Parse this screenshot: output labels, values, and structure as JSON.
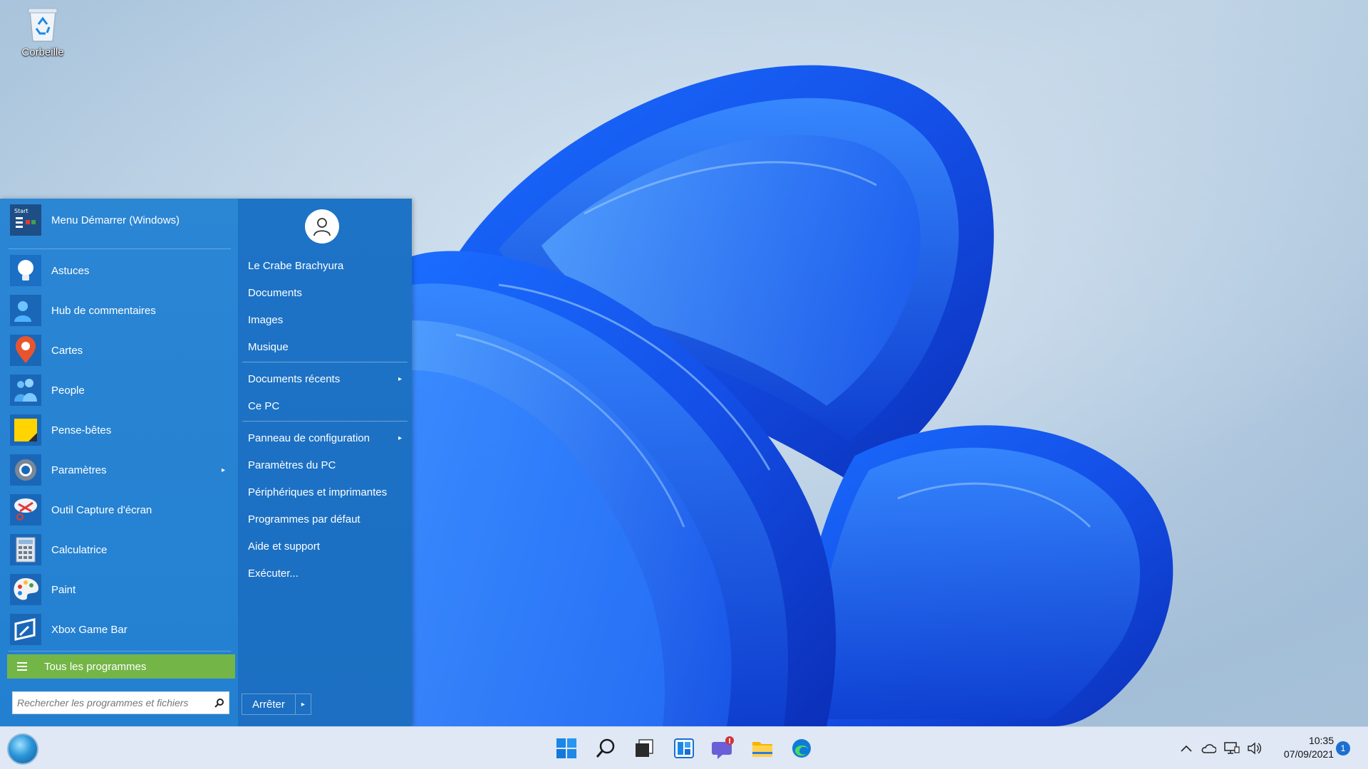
{
  "desktop": {
    "recycle_bin_label": "Corbeille"
  },
  "start_menu": {
    "pinned": [
      {
        "label": "Menu Démarrer (Windows)",
        "icon": "start-menu-icon"
      },
      {
        "label": "Astuces",
        "icon": "lightbulb-icon"
      },
      {
        "label": "Hub de commentaires",
        "icon": "person-feedback-icon"
      },
      {
        "label": "Cartes",
        "icon": "map-pin-icon"
      },
      {
        "label": "People",
        "icon": "people-icon"
      },
      {
        "label": "Pense-bêtes",
        "icon": "sticky-note-icon"
      },
      {
        "label": "Paramètres",
        "icon": "gear-icon",
        "has_submenu": true
      },
      {
        "label": "Outil Capture d'écran",
        "icon": "scissors-icon"
      },
      {
        "label": "Calculatrice",
        "icon": "calculator-icon"
      },
      {
        "label": "Paint",
        "icon": "palette-icon"
      },
      {
        "label": "Xbox Game Bar",
        "icon": "xbox-game-bar-icon"
      }
    ],
    "all_programs_label": "Tous les programmes",
    "search_placeholder": "Rechercher les programmes et fichiers",
    "right_links": [
      {
        "label": "Le Crabe Brachyura"
      },
      {
        "label": "Documents"
      },
      {
        "label": "Images"
      },
      {
        "label": "Musique"
      },
      {
        "label": "Documents récents",
        "has_submenu": true
      },
      {
        "label": "Ce PC"
      },
      {
        "label": "Panneau de configuration",
        "has_submenu": true
      },
      {
        "label": "Paramètres du PC"
      },
      {
        "label": "Périphériques et imprimantes"
      },
      {
        "label": "Programmes par défaut"
      },
      {
        "label": "Aide et support"
      },
      {
        "label": "Exécuter..."
      }
    ],
    "shutdown_label": "Arrêter",
    "accent_color": "#1e78cd",
    "all_programs_color": "#74b547"
  },
  "taskbar": {
    "apps": [
      {
        "name": "windows-start-icon"
      },
      {
        "name": "search-icon"
      },
      {
        "name": "task-view-icon"
      },
      {
        "name": "widgets-icon"
      },
      {
        "name": "teams-chat-icon",
        "badge": "!"
      },
      {
        "name": "file-explorer-icon"
      },
      {
        "name": "edge-icon"
      }
    ],
    "tray": [
      "chevron-up-icon",
      "onedrive-cloud-icon",
      "network-icon",
      "volume-icon"
    ],
    "time": "10:35",
    "date": "07/09/2021",
    "notification_count": "1"
  }
}
